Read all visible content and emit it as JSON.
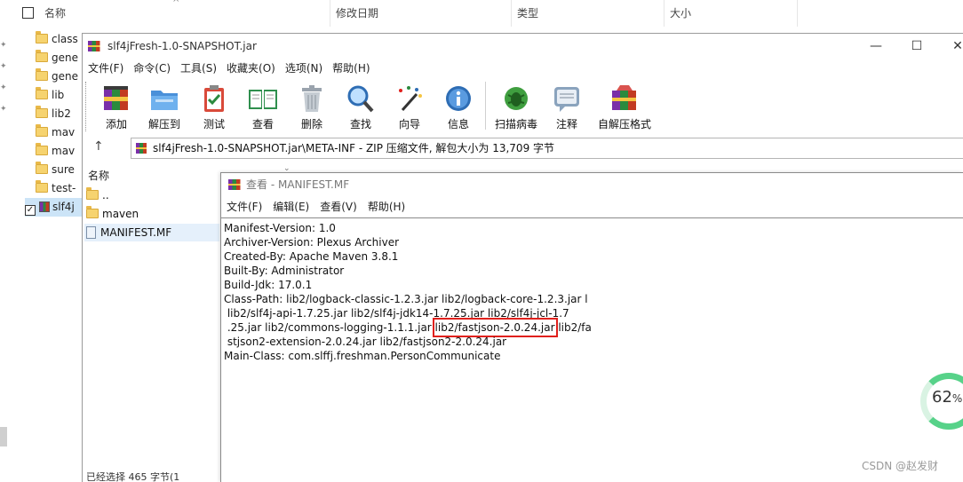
{
  "explorer": {
    "columns": {
      "name": "名称",
      "modified": "修改日期",
      "type": "类型",
      "size": "大小"
    },
    "rows": [
      {
        "label": "class"
      },
      {
        "label": "gene"
      },
      {
        "label": "gene"
      },
      {
        "label": "lib"
      },
      {
        "label": "lib2"
      },
      {
        "label": "mav"
      },
      {
        "label": "mav"
      },
      {
        "label": "sure"
      },
      {
        "label": "test-"
      },
      {
        "label": "slf4j"
      }
    ]
  },
  "rar": {
    "title": "slf4jFresh-1.0-SNAPSHOT.jar",
    "window_buttons": {
      "minimize": "—",
      "maximize": "☐",
      "close": "✕"
    },
    "menu": [
      "文件(F)",
      "命令(C)",
      "工具(S)",
      "收藏夹(O)",
      "选项(N)",
      "帮助(H)"
    ],
    "toolbar": [
      {
        "label": "添加",
        "icon": "add-archive-icon"
      },
      {
        "label": "解压到",
        "icon": "extract-to-icon"
      },
      {
        "label": "测试",
        "icon": "test-icon"
      },
      {
        "label": "查看",
        "icon": "view-book-icon"
      },
      {
        "label": "删除",
        "icon": "trash-icon"
      },
      {
        "label": "查找",
        "icon": "magnifier-icon"
      },
      {
        "label": "向导",
        "icon": "wizard-wand-icon"
      },
      {
        "label": "信息",
        "icon": "info-icon"
      },
      {
        "label": "扫描病毒",
        "icon": "bug-scan-icon"
      },
      {
        "label": "注释",
        "icon": "comment-icon"
      },
      {
        "label": "自解压格式",
        "icon": "sfx-box-icon"
      }
    ],
    "address": "slf4jFresh-1.0-SNAPSHOT.jar\\META-INF - ZIP 压缩文件, 解包大小为 13,709 字节",
    "list_header": "名称",
    "files": [
      {
        "label": "..",
        "kind": "folder"
      },
      {
        "label": "maven",
        "kind": "folder"
      },
      {
        "label": "MANIFEST.MF",
        "kind": "file"
      }
    ],
    "status": "已经选择 465 字节(1"
  },
  "viewer": {
    "title": "查看 - MANIFEST.MF",
    "menu": [
      "文件(F)",
      "编辑(E)",
      "查看(V)",
      "帮助(H)"
    ],
    "lines": [
      "Manifest-Version: 1.0",
      "Archiver-Version: Plexus Archiver",
      "Created-By: Apache Maven 3.8.1",
      "Built-By: Administrator",
      "Build-Jdk: 17.0.1",
      "Class-Path: lib2/logback-classic-1.2.3.jar lib2/logback-core-1.2.3.jar l",
      " lib2/slf4j-api-1.7.25.jar lib2/slf4j-jdk14-1.7.25.jar lib2/slf4j-jcl-1.7",
      " stjson2-extension-2.0.24.jar lib2/fastjson2-2.0.24.jar",
      "Main-Class: com.slffj.freshman.PersonCommunicate"
    ],
    "line8_before": " .25.jar lib2/commons-logging-1.1.1.jar ",
    "line8_highlight": "lib2/fastjson-2.0.24.jar",
    "line8_after": " lib2/fa"
  },
  "badge": {
    "value": "62",
    "unit": "%"
  },
  "watermark": "CSDN @赵发财",
  "colors": {
    "highlight_box": "#e0201c",
    "selection": "#cce4f7",
    "badge_ring": "#57d289"
  }
}
